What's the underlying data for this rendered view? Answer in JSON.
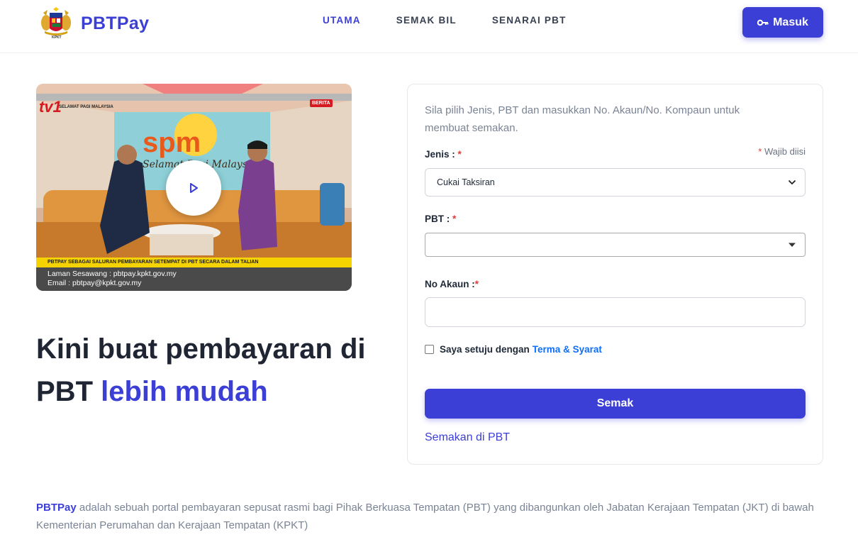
{
  "header": {
    "brand": "PBTPay",
    "crest_caption": "KPKT",
    "nav": [
      {
        "label": "UTAMA",
        "active": true
      },
      {
        "label": "SEMAK BIL",
        "active": false
      },
      {
        "label": "SENARAI PBT",
        "active": false
      }
    ],
    "login_label": "Masuk",
    "login_icon": "key-icon"
  },
  "video": {
    "channel": "tv1",
    "channel_tagline": "SELAMAT PAGI MALAYSIA",
    "badge": "BERITA",
    "ticker": "PBTPAY SEBAGAI SALURAN PEMBAYARAN SETEMPAT DI PBT SECARA DALAM TALIAN",
    "caption_line1": "Laman Sesawang : pbtpay.kpkt.gov.my",
    "caption_line2": "Email : pbtpay@kpkt.gov.my",
    "play_icon": "play-icon"
  },
  "hero": {
    "line1": "Kini buat pembayaran di",
    "line2_plain": "PBT ",
    "line2_accent": "lebih mudah"
  },
  "form": {
    "intro": "Sila pilih Jenis, PBT dan masukkan No. Akaun/No. Kompaun untuk membuat semakan.",
    "required_note": "Wajib diisi",
    "jenis_label": "Jenis :",
    "jenis_value": "Cukai Taksiran",
    "pbt_label": "PBT :",
    "pbt_value": "",
    "akaun_label": "No Akaun :",
    "akaun_value": "",
    "agree_text": "Saya setuju dengan",
    "terms_link": "Terma & Syarat",
    "submit_label": "Semak",
    "pbt_link": "Semakan di PBT"
  },
  "about": {
    "brand": "PBTPay",
    "text": " adalah sebuah portal pembayaran sepusat rasmi bagi Pihak Berkuasa Tempatan (PBT) yang dibangunkan oleh Jabatan Kerajaan Tempatan (JKT) di bawah Kementerian Perumahan dan Kerajaan Tempatan (KPKT)"
  },
  "colors": {
    "accent": "#3b3fd6",
    "required": "#e53935",
    "link": "#0d6efd"
  }
}
